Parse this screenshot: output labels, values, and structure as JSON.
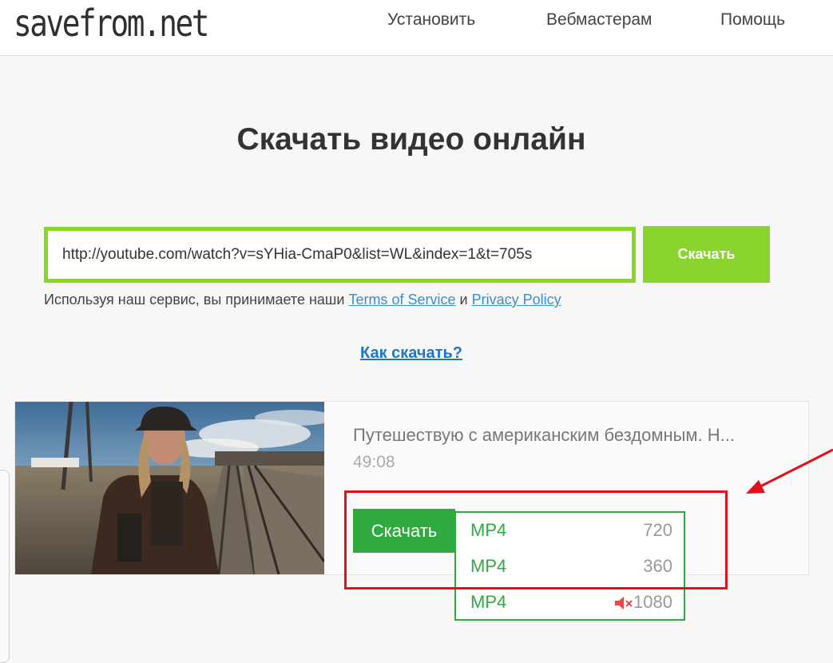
{
  "header": {
    "logo": "savefrom.net",
    "nav": {
      "install": "Установить",
      "webmasters": "Вебмастерам",
      "help": "Помощь"
    }
  },
  "main": {
    "title": "Скачать видео онлайн",
    "url_value": "http://youtube.com/watch?v=sYHia-CmaP0&list=WL&index=1&t=705s",
    "submit_label": "Скачать",
    "terms_prefix": "Используя наш сервис, вы принимаете наши",
    "terms_link": "Terms of Service",
    "terms_and": "и",
    "privacy_link": "Privacy Policy",
    "howto_link": "Как скачать?"
  },
  "result": {
    "title": "Путешествую с американским бездомным. Н...",
    "duration": "49:08",
    "download_label": "Скачать",
    "formats": [
      {
        "format": "MP4",
        "quality": "720"
      },
      {
        "format": "MP4",
        "quality": "360"
      },
      {
        "format": "MP4",
        "quality": "1080",
        "icon": "muted-speaker-icon"
      }
    ]
  },
  "colors": {
    "accent_green": "#89d62a",
    "download_green": "#2eaa3f",
    "annotation_red": "#e0101c",
    "link_blue": "#1a77c9"
  }
}
